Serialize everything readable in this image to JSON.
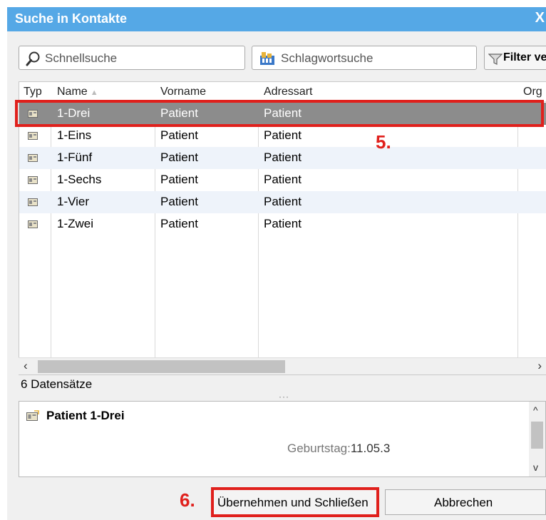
{
  "window": {
    "title": "Suche in Kontakte",
    "close_label": "X"
  },
  "toolbar": {
    "quick_search_placeholder": "Schnellsuche",
    "keyword_search_label": "Schlagwortsuche",
    "filter_label": "Filter ve"
  },
  "table": {
    "columns": [
      {
        "label": "Typ"
      },
      {
        "label": "Name",
        "sort": "ascending"
      },
      {
        "label": "Vorname"
      },
      {
        "label": "Adressart"
      },
      {
        "label": "Org"
      }
    ],
    "rows": [
      {
        "name": "1-Drei",
        "vorname": "Patient",
        "adressart": "Patient",
        "selected": true
      },
      {
        "name": "1-Eins",
        "vorname": "Patient",
        "adressart": "Patient"
      },
      {
        "name": "1-Fünf",
        "vorname": "Patient",
        "adressart": "Patient"
      },
      {
        "name": "1-Sechs",
        "vorname": "Patient",
        "adressart": "Patient"
      },
      {
        "name": "1-Vier",
        "vorname": "Patient",
        "adressart": "Patient"
      },
      {
        "name": "1-Zwei",
        "vorname": "Patient",
        "adressart": "Patient"
      }
    ],
    "row_icon": "contact-card-icon"
  },
  "status": {
    "record_count": "6 Datensätze"
  },
  "detail": {
    "title": "Patient 1-Drei",
    "birthday_label": "Geburtstag:",
    "birthday_value": "11.05.3"
  },
  "buttons": {
    "apply_close": "Übernehmen und Schließen",
    "cancel": "Abbrechen"
  },
  "annotations": {
    "step5": "5.",
    "step6": "6."
  },
  "colors": {
    "titlebar": "#55a8e6",
    "selected_row": "#8c8c8c",
    "highlight": "#e0201c",
    "alt_row": "#eef3fa"
  }
}
